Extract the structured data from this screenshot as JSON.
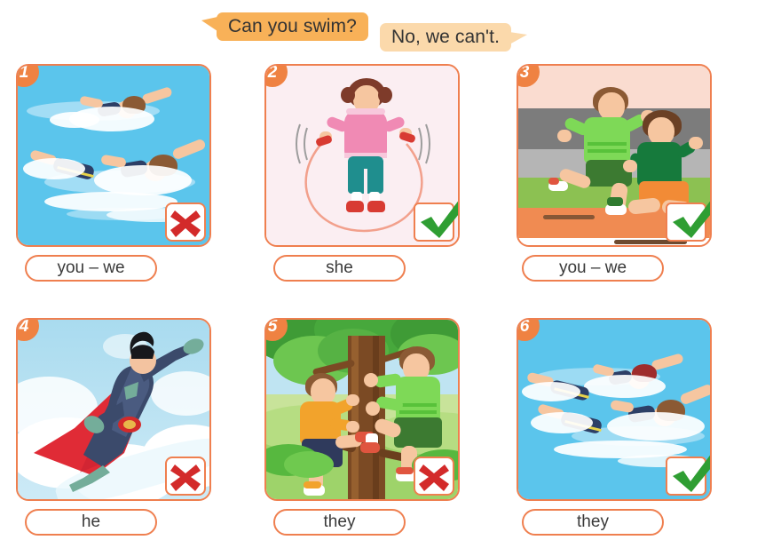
{
  "speech": {
    "question": "Can you swim?",
    "answer": "No, we can't.",
    "question_color": "#f8b158",
    "answer_color": "#fbd9ab"
  },
  "theme": {
    "border": "#ef7f4f",
    "badge": "#ef8242",
    "cross": "#d32a2a",
    "check": "#2f9e33",
    "text": "#3a3a3a"
  },
  "cards": [
    {
      "number": "1",
      "label": "you – we",
      "mark": "cross",
      "mark_icon": "red-x-icon",
      "scene": "two-children-swimming",
      "background": "#5bc5ec"
    },
    {
      "number": "2",
      "label": "she",
      "mark": "check",
      "mark_icon": "green-check-icon",
      "scene": "girl-skipping-rope",
      "background": "#fbeef2"
    },
    {
      "number": "3",
      "label": "you – we",
      "mark": "check",
      "mark_icon": "green-check-icon",
      "scene": "two-boys-running-track",
      "background": "#f9ddd2"
    },
    {
      "number": "4",
      "label": "he",
      "mark": "cross",
      "mark_icon": "red-x-icon",
      "scene": "superhero-flying-in-clouds",
      "background": "#aadcf0"
    },
    {
      "number": "5",
      "label": "they",
      "mark": "cross",
      "mark_icon": "red-x-icon",
      "scene": "two-boys-climbing-tree",
      "background": "#a8d870"
    },
    {
      "number": "6",
      "label": "they",
      "mark": "check",
      "mark_icon": "green-check-icon",
      "scene": "three-children-swimming",
      "background": "#5bc5ec"
    }
  ]
}
